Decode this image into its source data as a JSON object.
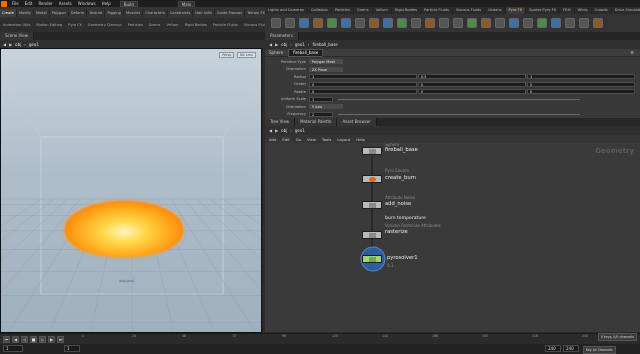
{
  "menubar": {
    "items": [
      "File",
      "Edit",
      "Render",
      "Assets",
      "Windows",
      "Help"
    ],
    "desktop": "Build",
    "desktop2": "Main"
  },
  "shelf": {
    "left_tabs": [
      "Create",
      "Modify",
      "Model",
      "Polygon",
      "Deform",
      "Texture",
      "Rigging",
      "Muscles",
      "Characters",
      "Constraints",
      "Hair Utils",
      "Guide Process",
      "Terrain FX",
      "Simple FX",
      "Cloud FX",
      "Volume"
    ],
    "left_tools": [
      "Animation Utils",
      "Motion Editing",
      "Pyro FX",
      "Geometry Cleanup",
      "Particles",
      "Grains",
      "Vellum",
      "Rigid Bodies",
      "Particle Fluids",
      "Viscous Fluids",
      "Oceans",
      "Fluid Containers"
    ],
    "right_tabs": [
      "Lights and Cameras",
      "Collisions",
      "Particles",
      "Grains",
      "Vellum",
      "Rigid Bodies",
      "Particle Fluids",
      "Viscous Fluids",
      "Oceans",
      "Pyro FX",
      "Sparse Pyro FX",
      "FEM",
      "Wires",
      "Crowds",
      "Drive Simulation"
    ],
    "right_active": "Pyro FX"
  },
  "scene_view": {
    "tab": "Scene View",
    "path": [
      "obj",
      "geo1"
    ],
    "badge_persp": "Persp",
    "badge_cam": "No cam",
    "ground_label": "/obj/geo1"
  },
  "params": {
    "tab": "Parameters",
    "path": [
      "obj",
      "geo1",
      "fireball_base"
    ],
    "node_type": "Sphere",
    "node_name": "fireball_base",
    "rows": [
      {
        "label": "Primitive Type",
        "values": [
          "Polygon Mesh"
        ],
        "dropdown": true
      },
      {
        "label": "Orientation",
        "values": [
          "ZX Plane"
        ],
        "dropdown": true
      },
      {
        "label": "Radius",
        "values": [
          "1",
          "0.5",
          "1"
        ]
      },
      {
        "label": "Center",
        "values": [
          "0",
          "0",
          "0"
        ]
      },
      {
        "label": "Rotate",
        "values": [
          "0",
          "0",
          "0"
        ]
      },
      {
        "label": "Uniform Scale",
        "values": [
          "1"
        ]
      },
      {
        "label": "Orientation",
        "values": [
          "Y Axis"
        ],
        "dropdown": true
      },
      {
        "label": "Frequency",
        "values": [
          "2"
        ]
      }
    ]
  },
  "network": {
    "tabs": [
      "Tree View",
      "Material Palette",
      "Asset Browser"
    ],
    "path": [
      "obj",
      "geo1"
    ],
    "menu": [
      "Add",
      "Edit",
      "Go",
      "View",
      "Tools",
      "Layout",
      "Help"
    ],
    "context_label": "Geometry",
    "nodes": [
      {
        "type": "Sphere",
        "name": "fireball_base"
      },
      {
        "type": "Pyro Source",
        "name": "create_burn"
      },
      {
        "type": "Attribute Noise",
        "name": "add_noise"
      },
      {
        "type": "Volume Rasterize Attributes",
        "name": "rasterize",
        "note": "burn temperature"
      },
      {
        "type": "",
        "name": "pyrosolver1",
        "note": "0.1"
      }
    ]
  },
  "timeline": {
    "ticks": [
      "1",
      "24",
      "48",
      "72",
      "96",
      "120",
      "144",
      "168",
      "192",
      "216",
      "240"
    ],
    "frame": "1",
    "start": "1",
    "end": "240",
    "end2": "240",
    "keys_label": "0 keys, 0/0 channels",
    "key_all": "Key All Channels",
    "auto_update": "Auto Update"
  }
}
